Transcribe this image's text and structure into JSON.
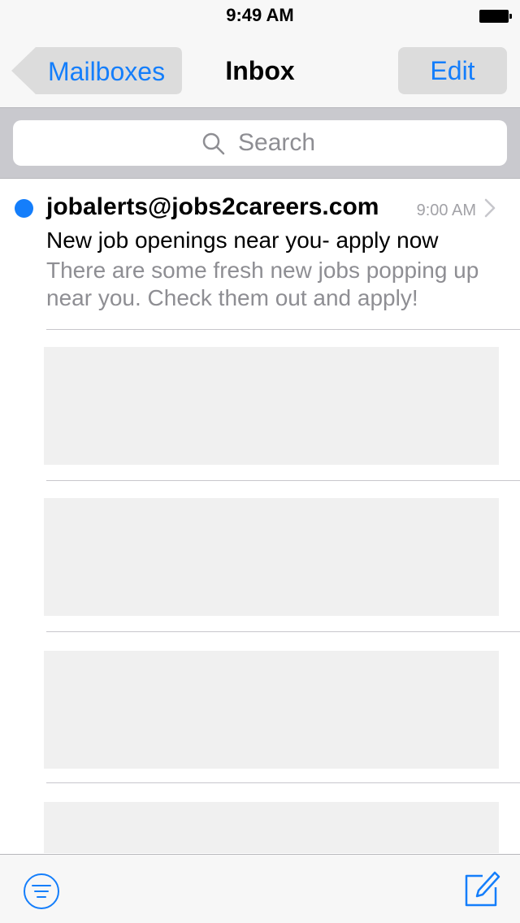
{
  "status_bar": {
    "time": "9:49 AM"
  },
  "nav": {
    "back_label": "Mailboxes",
    "title": "Inbox",
    "edit_label": "Edit"
  },
  "search": {
    "placeholder": "Search"
  },
  "messages": [
    {
      "sender": "jobalerts@jobs2careers.com",
      "time": "9:00 AM",
      "subject": "New job openings near you- apply now",
      "preview": "There are some fresh new jobs popping up near you. Check them out and apply!",
      "unread": true
    }
  ],
  "colors": {
    "accent": "#147efb",
    "secondary_text": "#8e8e93",
    "placeholder_fill": "#f0f0f0"
  },
  "icons": {
    "filter": "filter-icon",
    "compose": "compose-icon",
    "search": "search-icon",
    "chevron": "chevron-right-icon",
    "back": "back-arrow-shape"
  }
}
